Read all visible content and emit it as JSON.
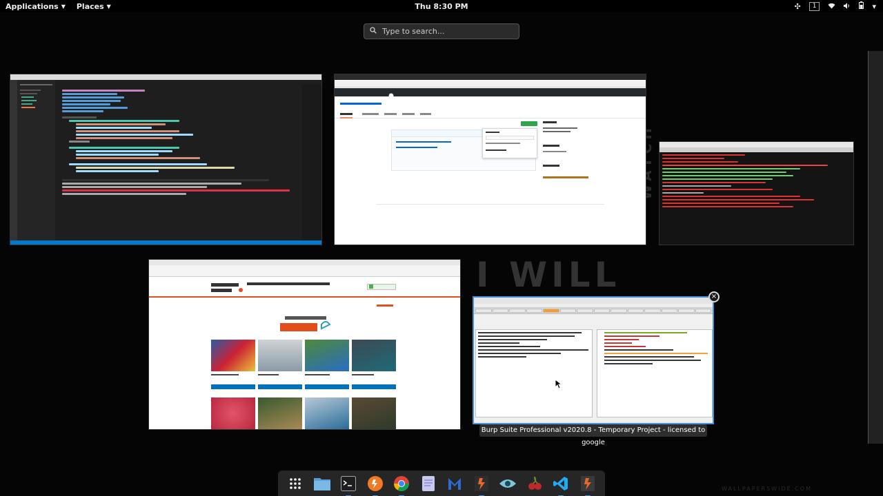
{
  "topbar": {
    "applications_label": "Applications",
    "places_label": "Places",
    "clock": "Thu  8:30 PM",
    "workspace_number": "1"
  },
  "search": {
    "placeholder": "Type to search..."
  },
  "windows": {
    "burp": {
      "caption": "Burp Suite Professional v2020.8 - Temporary Project - licensed to google"
    }
  },
  "background": {
    "watermark_text": "I WILL",
    "watermark_side": "WATCH",
    "footer_watermark": "WALLPAPERSWIDE.COM"
  },
  "dock": {
    "items": [
      {
        "name": "app-grid-icon",
        "color": "#ffffff"
      },
      {
        "name": "files-icon",
        "color": "#5a9fd4"
      },
      {
        "name": "terminal-icon",
        "color": "#2e2e2e"
      },
      {
        "name": "burp-icon",
        "color": "#f07b24"
      },
      {
        "name": "chrome-icon",
        "color": "#4caf50"
      },
      {
        "name": "notes-icon",
        "color": "#c9c9f0"
      },
      {
        "name": "maltego-icon",
        "color": "#2e6ad0"
      },
      {
        "name": "burp-pro-icon",
        "color": "#e8672a"
      },
      {
        "name": "eye-icon",
        "color": "#7ec7d6"
      },
      {
        "name": "cherrytree-icon",
        "color": "#c0282e"
      },
      {
        "name": "vscode-icon",
        "color": "#23a9f2"
      },
      {
        "name": "burp-community-icon",
        "color": "#e8672a"
      }
    ]
  }
}
